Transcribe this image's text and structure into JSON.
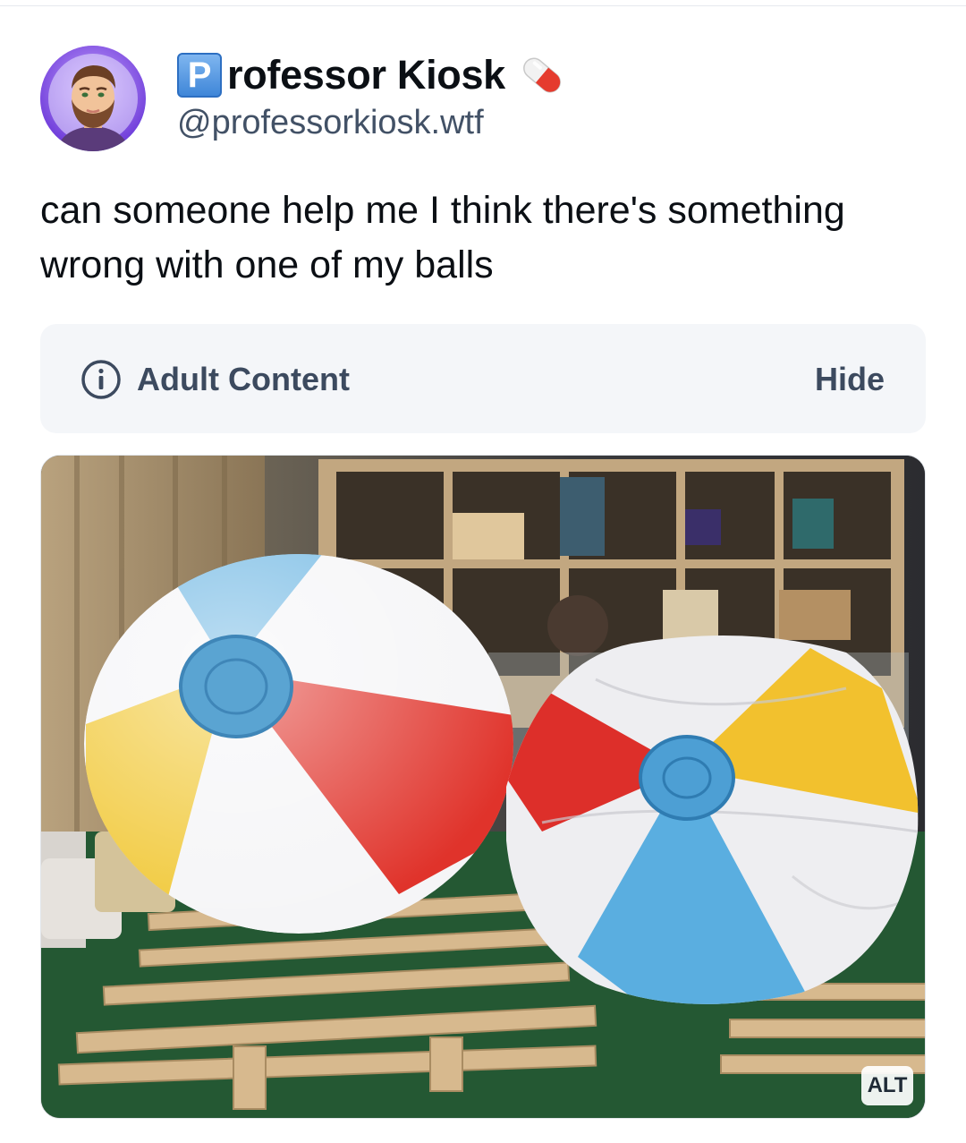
{
  "author": {
    "badge_letter": "P",
    "display_name": "rofessor Kiosk",
    "handle": "@professorkiosk.wtf",
    "avatar_icon": "avatar-cartoon-man",
    "suffix_icon": "pill-capsule-icon"
  },
  "post": {
    "text": "can someone help me I think there's something wrong with one of my balls"
  },
  "content_warning": {
    "label": "Adult Content",
    "icon": "info-icon",
    "hide_label": "Hide"
  },
  "media": {
    "alt_label": "ALT"
  },
  "colors": {
    "text_primary": "#0b0f14",
    "text_secondary": "#425166",
    "warning_bg": "#f4f6f9",
    "warning_text": "#3c4a5f"
  }
}
